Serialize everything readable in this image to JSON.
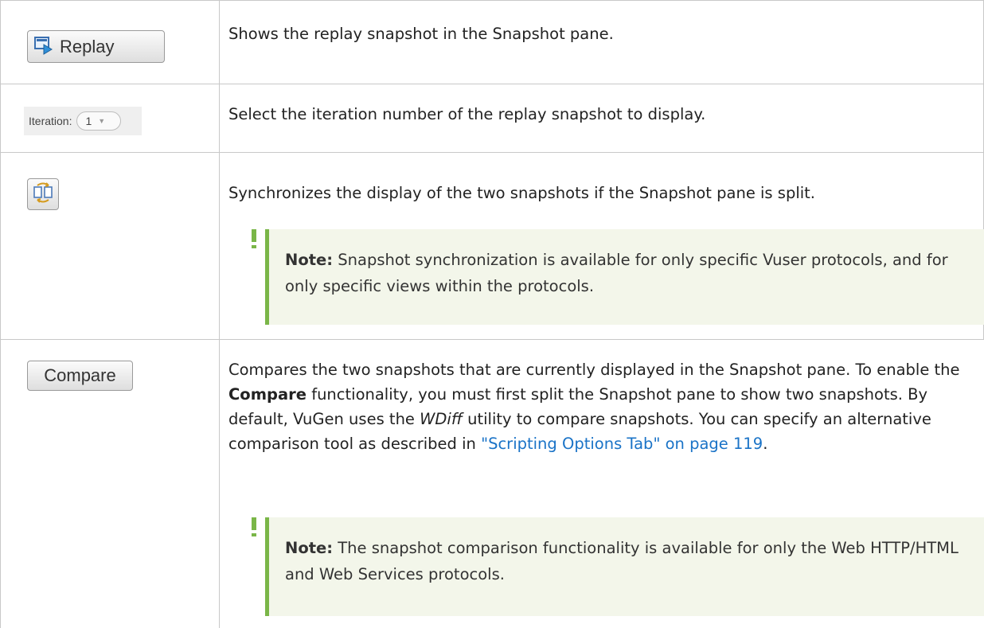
{
  "rows": [
    {
      "control": {
        "type": "button",
        "label": "Replay",
        "icon": "replay-icon"
      },
      "description": "Shows the replay snapshot in the Snapshot pane."
    },
    {
      "control": {
        "type": "dropdown",
        "label": "Iteration:",
        "selected": "1"
      },
      "description": "Select the iteration number of the replay snapshot to display."
    },
    {
      "control": {
        "type": "icon-button",
        "icon": "sync-icon"
      },
      "description": "Synchronizes the display of the two snapshots if the Snapshot pane is split.",
      "note": {
        "label": "Note:",
        "text": "Snapshot synchronization is available for only specific Vuser protocols, and for only specific views within the protocols."
      }
    },
    {
      "control": {
        "type": "button",
        "label": "Compare"
      },
      "description": {
        "part1": "Compares the two snapshots that are currently displayed in the Snapshot pane. To enable the ",
        "bold": "Compare",
        "part2": " functionality, you must first split the Snapshot pane to show two snapshots. By default, VuGen uses the ",
        "italic": "WDiff",
        "part3": " utility to compare snapshots. You can specify an alternative comparison tool as described in ",
        "link": "\"Scripting Options Tab\" on page 119",
        "part4": "."
      },
      "note": {
        "label": "Note:",
        "text": "The snapshot comparison functionality is available for only the Web HTTP/HTML and Web Services protocols."
      }
    }
  ],
  "colors": {
    "accent_green": "#7ab648",
    "note_bg": "#f3f6ea",
    "link": "#1a73c7",
    "grid": "#c8c8c8"
  }
}
